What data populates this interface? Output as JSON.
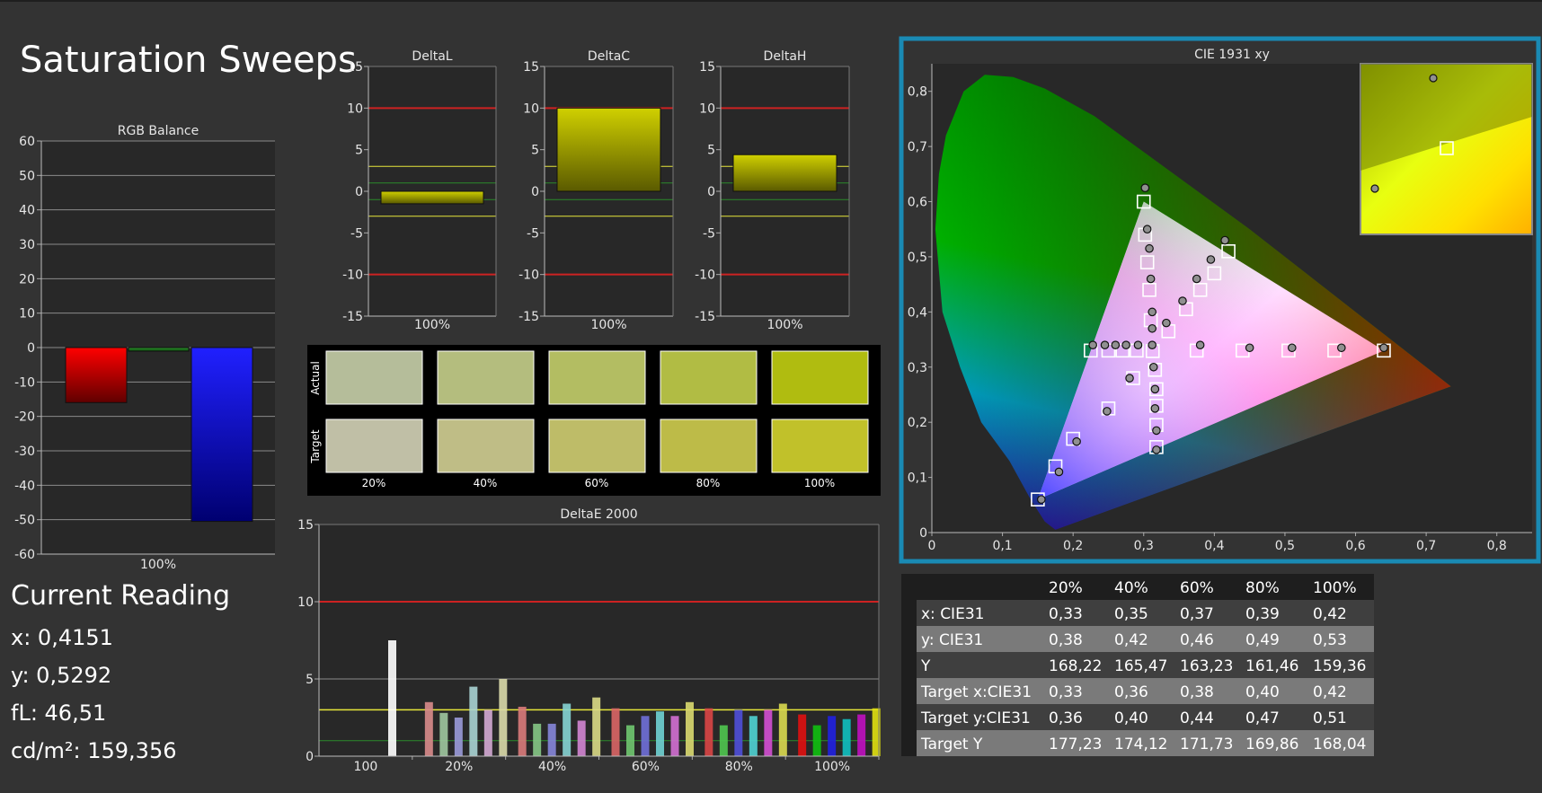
{
  "page_title": "Saturation Sweeps",
  "current_reading": {
    "title": "Current Reading",
    "x": "x: 0,4151",
    "y": "y: 0,5292",
    "fl": "fL: 46,51",
    "cdm2": "cd/m²: 159,356"
  },
  "colors": {
    "background": "#333333",
    "plot_background": "#282828",
    "highlight_border": "#1a8ab4",
    "limit_red": "#cc2222",
    "limit_yellow": "#e6e63a",
    "limit_green": "#2b8a2b",
    "bar_yellow": "#c8c800",
    "rgb_red": "#e00000",
    "rgb_green": "#1f7a1f",
    "rgb_blue": "#1010e0"
  },
  "swatches": {
    "row_labels": [
      "Actual",
      "Target"
    ],
    "col_labels": [
      "20%",
      "40%",
      "60%",
      "80%",
      "100%"
    ],
    "actual_colors": [
      "#b5bd9a",
      "#b4bd7e",
      "#b3bd62",
      "#b1bc44",
      "#b0bc10"
    ],
    "target_colors": [
      "#c0bfa6",
      "#bfbd86",
      "#bebc68",
      "#bdbb48",
      "#c1c12a"
    ]
  },
  "table": {
    "header": [
      "",
      "20%",
      "40%",
      "60%",
      "80%",
      "100%"
    ],
    "rows": [
      [
        "x: CIE31",
        "0,33",
        "0,35",
        "0,37",
        "0,39",
        "0,42"
      ],
      [
        "y: CIE31",
        "0,38",
        "0,42",
        "0,46",
        "0,49",
        "0,53"
      ],
      [
        "Y",
        "168,22",
        "165,47",
        "163,23",
        "161,46",
        "159,36"
      ],
      [
        "Target x:CIE31",
        "0,33",
        "0,36",
        "0,38",
        "0,40",
        "0,42"
      ],
      [
        "Target y:CIE31",
        "0,36",
        "0,40",
        "0,44",
        "0,47",
        "0,51"
      ],
      [
        "Target Y",
        "177,23",
        "174,12",
        "171,73",
        "169,86",
        "168,04"
      ]
    ]
  },
  "chart_data": [
    {
      "id": "rgb-balance",
      "type": "bar",
      "title": "RGB Balance",
      "categories": [
        "100%"
      ],
      "series": [
        {
          "name": "Red",
          "color": "#e00000",
          "values": [
            -16
          ]
        },
        {
          "name": "Green",
          "color": "#1f7a1f",
          "values": [
            -1
          ]
        },
        {
          "name": "Blue",
          "color": "#1010e0",
          "values": [
            -50.5
          ]
        }
      ],
      "ylim": [
        -60,
        60
      ],
      "yticks": [
        "60",
        "50",
        "40",
        "30",
        "20",
        "10",
        "0",
        "-10",
        "-20",
        "-30",
        "-40",
        "-50",
        "-60"
      ],
      "grid": true
    },
    {
      "id": "delta-l",
      "type": "bar",
      "title": "DeltaL",
      "categories": [
        "100%"
      ],
      "values": [
        -1.5
      ],
      "ylim": [
        -15,
        15
      ],
      "yticks": [
        "15",
        "10",
        "5",
        "0",
        "-5",
        "-10",
        "-15"
      ],
      "limits": {
        "red": [
          10,
          -10
        ],
        "yellow": [
          3,
          -3
        ],
        "green": [
          1,
          -1
        ]
      }
    },
    {
      "id": "delta-c",
      "type": "bar",
      "title": "DeltaC",
      "categories": [
        "100%"
      ],
      "values": [
        10
      ],
      "ylim": [
        -15,
        15
      ],
      "yticks": [
        "15",
        "10",
        "5",
        "0",
        "-5",
        "-10",
        "-15"
      ],
      "limits": {
        "red": [
          10,
          -10
        ],
        "yellow": [
          3,
          -3
        ],
        "green": [
          1,
          -1
        ]
      }
    },
    {
      "id": "delta-h",
      "type": "bar",
      "title": "DeltaH",
      "categories": [
        "100%"
      ],
      "values": [
        4.4
      ],
      "ylim": [
        -15,
        15
      ],
      "yticks": [
        "15",
        "10",
        "5",
        "0",
        "-5",
        "-10",
        "-15"
      ],
      "limits": {
        "red": [
          10,
          -10
        ],
        "yellow": [
          3,
          -3
        ],
        "green": [
          1,
          -1
        ]
      }
    },
    {
      "id": "delta-e",
      "type": "bar",
      "title": "DeltaE 2000",
      "categories": [
        "100",
        "20%",
        "40%",
        "60%",
        "80%",
        "100%"
      ],
      "ylim": [
        0,
        15
      ],
      "yticks": [
        "15",
        "10",
        "5",
        "0"
      ],
      "limits": {
        "red": 10,
        "yellow": 3,
        "green": 1
      },
      "groups": [
        {
          "label": "100",
          "bars": [
            {
              "color": "#ffffff",
              "value": 7.5
            }
          ]
        },
        {
          "label": "20%",
          "bars": [
            {
              "color": "#d98b8b",
              "value": 3.5
            },
            {
              "color": "#9fc79f",
              "value": 2.8
            },
            {
              "color": "#9a9ad9",
              "value": 2.5
            },
            {
              "color": "#a9d3d3",
              "value": 4.5
            },
            {
              "color": "#d3a9d3",
              "value": 3.0
            },
            {
              "color": "#d9d9a9",
              "value": 5.0
            }
          ]
        },
        {
          "label": "40%",
          "bars": [
            {
              "color": "#d97a7a",
              "value": 3.2
            },
            {
              "color": "#85c785",
              "value": 2.1
            },
            {
              "color": "#8585d9",
              "value": 2.1
            },
            {
              "color": "#85d3d3",
              "value": 3.4
            },
            {
              "color": "#d385d3",
              "value": 2.3
            },
            {
              "color": "#d9d985",
              "value": 3.8
            }
          ]
        },
        {
          "label": "60%",
          "bars": [
            {
              "color": "#d96565",
              "value": 3.1
            },
            {
              "color": "#6fc76f",
              "value": 2.0
            },
            {
              "color": "#6f6fd9",
              "value": 2.6
            },
            {
              "color": "#6fd3d3",
              "value": 2.9
            },
            {
              "color": "#d36fd3",
              "value": 2.6
            },
            {
              "color": "#d9d96f",
              "value": 3.5
            }
          ]
        },
        {
          "label": "80%",
          "bars": [
            {
              "color": "#d94545",
              "value": 3.1
            },
            {
              "color": "#4fc74f",
              "value": 2.0
            },
            {
              "color": "#4f4fd9",
              "value": 3.0
            },
            {
              "color": "#4fd3d3",
              "value": 2.6
            },
            {
              "color": "#d34fd3",
              "value": 3.0
            },
            {
              "color": "#d9d94f",
              "value": 3.4
            }
          ]
        },
        {
          "label": "100%",
          "bars": [
            {
              "color": "#e01010",
              "value": 2.7
            },
            {
              "color": "#10c010",
              "value": 2.0
            },
            {
              "color": "#2020e0",
              "value": 2.6
            },
            {
              "color": "#10c0c0",
              "value": 2.4
            },
            {
              "color": "#c010c0",
              "value": 2.7
            },
            {
              "color": "#e0e010",
              "value": 3.1
            }
          ]
        }
      ]
    },
    {
      "id": "cie-1931",
      "type": "scatter",
      "title": "CIE 1931 xy",
      "xlim": [
        0,
        0.85
      ],
      "ylim": [
        0,
        0.85
      ],
      "xticks": [
        "0",
        "0,1",
        "0,2",
        "0,3",
        "0,4",
        "0,5",
        "0,6",
        "0,7",
        "0,8"
      ],
      "yticks": [
        "0",
        "0,1",
        "0,2",
        "0,3",
        "0,4",
        "0,5",
        "0,6",
        "0,7",
        "0,8"
      ],
      "gamut": {
        "red": [
          0.64,
          0.33
        ],
        "green": [
          0.3,
          0.6
        ],
        "blue": [
          0.15,
          0.06
        ],
        "white": [
          0.3127,
          0.329
        ]
      },
      "targets": [
        [
          0.15,
          0.06
        ],
        [
          0.175,
          0.12
        ],
        [
          0.2,
          0.17
        ],
        [
          0.25,
          0.225
        ],
        [
          0.285,
          0.28
        ],
        [
          0.3127,
          0.329
        ],
        [
          0.225,
          0.33
        ],
        [
          0.25,
          0.33
        ],
        [
          0.27,
          0.33
        ],
        [
          0.29,
          0.33
        ],
        [
          0.3,
          0.6
        ],
        [
          0.302,
          0.54
        ],
        [
          0.305,
          0.49
        ],
        [
          0.308,
          0.44
        ],
        [
          0.31,
          0.385
        ],
        [
          0.64,
          0.33
        ],
        [
          0.57,
          0.33
        ],
        [
          0.505,
          0.33
        ],
        [
          0.44,
          0.33
        ],
        [
          0.375,
          0.33
        ],
        [
          0.318,
          0.155
        ],
        [
          0.318,
          0.195
        ],
        [
          0.318,
          0.23
        ],
        [
          0.318,
          0.26
        ],
        [
          0.316,
          0.295
        ],
        [
          0.42,
          0.51
        ],
        [
          0.4,
          0.47
        ],
        [
          0.38,
          0.44
        ],
        [
          0.36,
          0.405
        ],
        [
          0.335,
          0.365
        ]
      ],
      "measured": [
        [
          0.155,
          0.06
        ],
        [
          0.18,
          0.11
        ],
        [
          0.205,
          0.165
        ],
        [
          0.248,
          0.22
        ],
        [
          0.28,
          0.28
        ],
        [
          0.312,
          0.34
        ],
        [
          0.228,
          0.34
        ],
        [
          0.245,
          0.34
        ],
        [
          0.26,
          0.34
        ],
        [
          0.275,
          0.34
        ],
        [
          0.292,
          0.34
        ],
        [
          0.302,
          0.625
        ],
        [
          0.305,
          0.55
        ],
        [
          0.308,
          0.515
        ],
        [
          0.31,
          0.46
        ],
        [
          0.312,
          0.4
        ],
        [
          0.64,
          0.335
        ],
        [
          0.58,
          0.335
        ],
        [
          0.51,
          0.335
        ],
        [
          0.45,
          0.335
        ],
        [
          0.38,
          0.34
        ],
        [
          0.318,
          0.15
        ],
        [
          0.318,
          0.185
        ],
        [
          0.316,
          0.225
        ],
        [
          0.316,
          0.26
        ],
        [
          0.314,
          0.3
        ],
        [
          0.312,
          0.37
        ],
        [
          0.415,
          0.53
        ],
        [
          0.395,
          0.495
        ],
        [
          0.375,
          0.46
        ],
        [
          0.355,
          0.42
        ],
        [
          0.332,
          0.38
        ]
      ]
    }
  ]
}
